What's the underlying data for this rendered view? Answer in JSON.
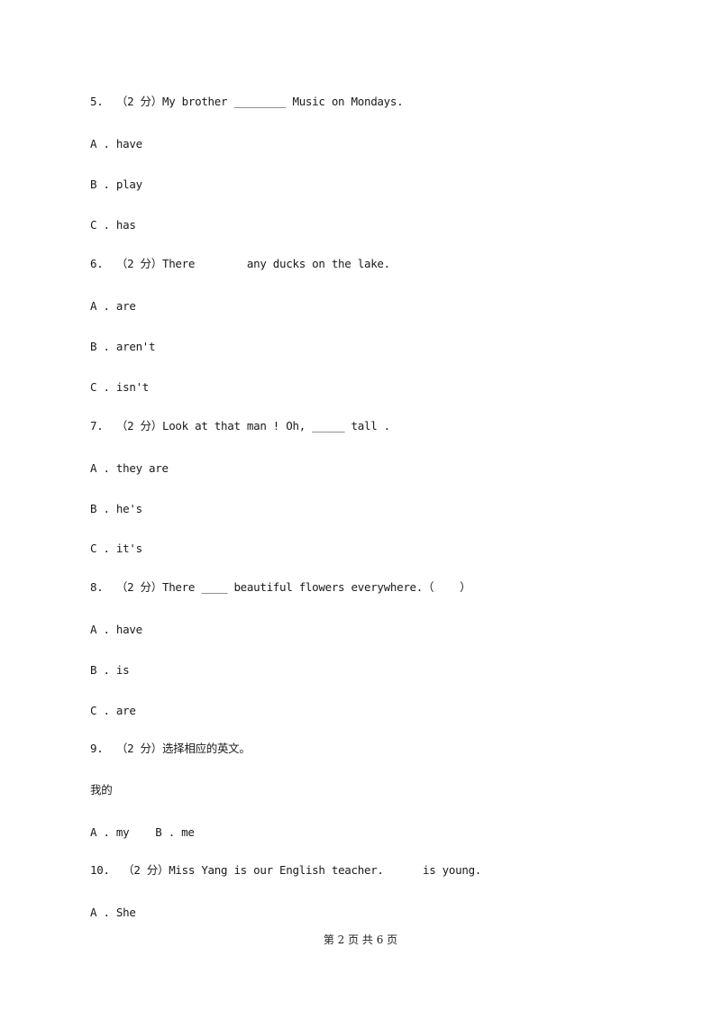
{
  "questions": [
    {
      "number": "5.",
      "score": "（2 分）",
      "text": "My brother ________ Music on Mondays.",
      "options": [
        "A . have",
        "B . play",
        "C . has"
      ]
    },
    {
      "number": "6.",
      "score": "（2 分）",
      "text": "There        any ducks on the lake.",
      "options": [
        "A . are",
        "B . aren't",
        "C . isn't"
      ]
    },
    {
      "number": "7.",
      "score": "（2 分）",
      "text": "Look at that man ! Oh, _____ tall .",
      "options": [
        "A . they are",
        "B . he's",
        "C . it's"
      ]
    },
    {
      "number": "8.",
      "score": "（2 分）",
      "text": "There ____ beautiful flowers everywhere.（    ）",
      "options": [
        "A . have",
        "B . is",
        "C . are"
      ]
    },
    {
      "number": "9.",
      "score": "（2 分）",
      "text": "选择相应的英文。",
      "prompt": "我的",
      "options_inline": "A . my    B . me"
    },
    {
      "number": "10.",
      "score": "（2 分）",
      "text": "Miss Yang is our English teacher.      is young.",
      "options": [
        "A . She"
      ]
    }
  ],
  "footer": {
    "page_label": "第 2 页 共 6 页"
  }
}
